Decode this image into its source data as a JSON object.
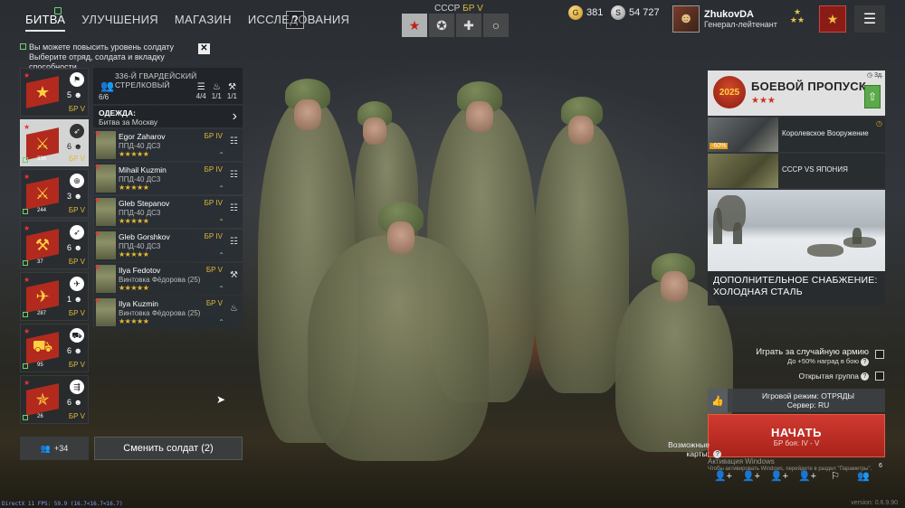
{
  "nav": {
    "items": [
      "БИТВА",
      "УЛУЧШЕНИЯ",
      "МАГАЗИН",
      "ИССЛЕДОВАНИЯ"
    ],
    "help": "?"
  },
  "nation": {
    "name": "СССР",
    "br": "БР V",
    "tabs": [
      "★",
      "✪",
      "✚",
      "○"
    ]
  },
  "currency": {
    "gold": "381",
    "silver": "54 727"
  },
  "profile": {
    "name": "ZhukovDA",
    "rank": "Генерал-лейтенант",
    "rank_stars": "★\n★★"
  },
  "notification": {
    "line1": "Вы можете повысить уровень солдату",
    "line2": "Выберите отряд, солдата и вкладку способности",
    "close": "✕"
  },
  "squads": [
    {
      "count": "5",
      "br": "БР V",
      "type_icon": "⚑",
      "emblem_icon": "★",
      "num": "",
      "active": false
    },
    {
      "count": "6",
      "br": "БР V",
      "type_icon": "➶",
      "emblem_icon": "⚔",
      "num": "336",
      "active": true
    },
    {
      "count": "3",
      "br": "БР V",
      "type_icon": "⊕",
      "emblem_icon": "⚔",
      "num": "244",
      "active": false
    },
    {
      "count": "6",
      "br": "БР V",
      "type_icon": "➶",
      "emblem_icon": "⚒",
      "num": "37",
      "active": false
    },
    {
      "count": "1",
      "br": "БР V",
      "type_icon": "✈",
      "emblem_icon": "✈",
      "num": "287",
      "active": false
    },
    {
      "count": "6",
      "br": "БР V",
      "type_icon": "⛟",
      "emblem_icon": "⛟",
      "num": "95",
      "active": false
    },
    {
      "count": "6",
      "br": "БР V",
      "type_icon": "⇶",
      "emblem_icon": "✯",
      "num": "26",
      "active": false
    }
  ],
  "detail": {
    "title": "336-Й ГВАРДЕЙСКИЙ СТРЕЛКОВЫЙ",
    "count": "6/6",
    "stats": [
      {
        "value": "4/4"
      },
      {
        "value": "1/1"
      },
      {
        "value": "1/1"
      }
    ],
    "outfit_label": "ОДЕЖДА:",
    "outfit_value": "Битва за Москву",
    "arrow": "›"
  },
  "soldiers": [
    {
      "name": "Egor Zaharov",
      "weapon": "ППД-40 ДС3",
      "br": "БР IV",
      "stars": "★★★★★"
    },
    {
      "name": "Mihail Kuzmin",
      "weapon": "ППД-40 ДС3",
      "br": "БР IV",
      "stars": "★★★★★"
    },
    {
      "name": "Gleb Stepanov",
      "weapon": "ППД-40 ДС3",
      "br": "БР IV",
      "stars": "★★★★★"
    },
    {
      "name": "Gleb Gorshkov",
      "weapon": "ППД-40 ДС3",
      "br": "БР IV",
      "stars": "★★★★★"
    },
    {
      "name": "Ilya Fedotov",
      "weapon": "Винтовка Фёдорова (25)",
      "br": "БР V",
      "stars": "★★★★★"
    },
    {
      "name": "Ilya Kuzmin",
      "weapon": "Винтовка Фёдорова (25)",
      "br": "БР V",
      "stars": "★★★★★"
    }
  ],
  "bottom_left": {
    "add_label": "+34",
    "change_label": "Сменить солдат (2)",
    "dx_info": "DirectX 11 FPS: 59.9 (16.7<16.7<16.7)"
  },
  "battle_pass": {
    "title": "БОЕВОЙ ПРОПУСК",
    "stars": "★★★",
    "emblem": "2025",
    "time": "3д."
  },
  "promos": [
    {
      "label": "Королевское Вооружение",
      "discount": "-60%"
    },
    {
      "label": "СССР VS ЯПОНИЯ",
      "discount": ""
    }
  ],
  "supply": {
    "line1": "ДОПОЛНИТЕЛЬНОЕ СНАБЖЕНИЕ:",
    "line2": "ХОЛОДНАЯ СТАЛЬ"
  },
  "options": {
    "random_army": "Играть за случайную армию",
    "random_army_note": "До +50% наград в бою",
    "open_group": "Открытая группа"
  },
  "mode": {
    "line1": "Игровой режим: ОТРЯДЫ",
    "line2": "Сервер: RU"
  },
  "start": {
    "label": "НАЧАТЬ",
    "sub": "БР боя: IV - V"
  },
  "maps_label": "Возможные карты:",
  "activation": {
    "title": "Активация Windows",
    "note": "Чтобы активировать Windows, перейдите в раздел \"Параметры\"."
  },
  "notif_count": "6",
  "version": "version: 0.6.9.90"
}
